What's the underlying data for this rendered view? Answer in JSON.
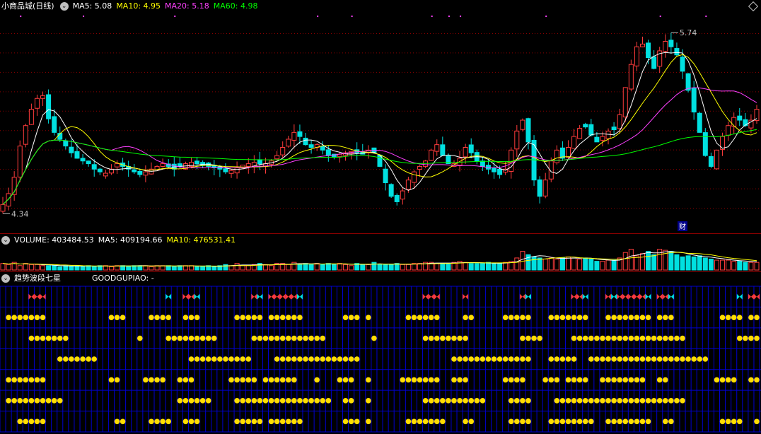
{
  "price_header": {
    "title": "小商品城(日线)",
    "ma5": "MA5: 5.08",
    "ma10": "MA10: 4.95",
    "ma20": "MA20: 5.18",
    "ma60": "MA60: 4.98"
  },
  "volume_header": {
    "volume": "VOLUME: 403484.53",
    "ma5": "MA5: 409194.66",
    "ma10": "MA10: 476531.41"
  },
  "indicator_header": {
    "title": "趋势波段七星",
    "good": "GOODGUPIAO: -"
  },
  "annotations": {
    "high": "5.74",
    "low": "4.34",
    "fin": "财"
  },
  "colors": {
    "up": "#ff3c3c",
    "down": "#00e0e0",
    "ma5": "#ffffff",
    "ma10": "#ffff00",
    "ma20": "#ff40ff",
    "ma60": "#00ff00",
    "grid": "#0000d0",
    "dot": "#ffdd00",
    "frame": "#8b0000"
  },
  "chart_data": {
    "type": "candlestick",
    "price_range": [
      4.25,
      5.82
    ],
    "closes": [
      4.42,
      4.5,
      4.62,
      4.85,
      5.0,
      5.12,
      5.2,
      5.22,
      5.05,
      4.95,
      4.9,
      4.85,
      4.8,
      4.76,
      4.74,
      4.72,
      4.68,
      4.66,
      4.65,
      4.68,
      4.72,
      4.7,
      4.68,
      4.66,
      4.64,
      4.66,
      4.68,
      4.7,
      4.72,
      4.7,
      4.68,
      4.7,
      4.72,
      4.73,
      4.72,
      4.71,
      4.7,
      4.69,
      4.68,
      4.66,
      4.67,
      4.69,
      4.71,
      4.72,
      4.73,
      4.72,
      4.72,
      4.74,
      4.78,
      4.84,
      4.9,
      4.95,
      4.92,
      4.86,
      4.84,
      4.86,
      4.82,
      4.78,
      4.77,
      4.79,
      4.8,
      4.81,
      4.8,
      4.79,
      4.82,
      4.8,
      4.7,
      4.58,
      4.48,
      4.44,
      4.52,
      4.6,
      4.66,
      4.7,
      4.74,
      4.82,
      4.86,
      4.78,
      4.72,
      4.72,
      4.76,
      4.84,
      4.8,
      4.74,
      4.7,
      4.68,
      4.66,
      4.64,
      4.68,
      4.82,
      4.96,
      5.04,
      4.88,
      4.6,
      4.48,
      4.6,
      4.74,
      4.82,
      4.76,
      4.84,
      4.92,
      4.98,
      4.99,
      4.93,
      4.88,
      4.92,
      4.96,
      4.97,
      5.08,
      5.28,
      5.45,
      5.58,
      5.6,
      5.5,
      5.42,
      5.55,
      5.62,
      5.58,
      5.52,
      5.4,
      5.26,
      5.1,
      4.95,
      4.78,
      4.7,
      4.82,
      4.92,
      5.0,
      5.06,
      5.04,
      5.0,
      5.04,
      5.12
    ],
    "volumes": [
      0.3,
      0.25,
      0.35,
      0.2,
      0.3,
      0.25,
      0.25,
      0.2,
      0.2,
      0.2,
      0.15,
      0.2,
      0.18,
      0.2,
      0.15,
      0.2,
      0.15,
      0.2,
      0.2,
      0.15,
      0.2,
      0.2,
      0.18,
      0.2,
      0.2,
      0.2,
      0.15,
      0.2,
      0.2,
      0.2,
      0.15,
      0.2,
      0.2,
      0.2,
      0.15,
      0.15,
      0.2,
      0.15,
      0.2,
      0.25,
      0.2,
      0.3,
      0.2,
      0.2,
      0.25,
      0.3,
      0.25,
      0.2,
      0.3,
      0.3,
      0.25,
      0.35,
      0.25,
      0.3,
      0.25,
      0.3,
      0.25,
      0.3,
      0.25,
      0.3,
      0.25,
      0.2,
      0.3,
      0.25,
      0.25,
      0.35,
      0.25,
      0.25,
      0.25,
      0.3,
      0.25,
      0.25,
      0.3,
      0.3,
      0.35,
      0.35,
      0.3,
      0.3,
      0.3,
      0.35,
      0.4,
      0.35,
      0.3,
      0.3,
      0.3,
      0.35,
      0.3,
      0.3,
      0.35,
      0.4,
      0.55,
      0.85,
      0.7,
      0.6,
      0.55,
      0.5,
      0.55,
      0.5,
      0.55,
      0.6,
      0.55,
      0.5,
      0.55,
      0.5,
      0.4,
      0.4,
      0.45,
      0.45,
      0.55,
      0.8,
      0.95,
      0.65,
      0.75,
      0.85,
      0.7,
      0.95,
      0.9,
      0.85,
      0.7,
      0.6,
      0.65,
      0.6,
      0.65,
      0.55,
      0.5,
      0.45,
      0.45,
      0.45,
      0.4,
      0.4,
      0.35,
      0.35,
      0.35
    ],
    "high_label": 5.74,
    "low_label": 4.34,
    "ma_legend": [
      "MA5",
      "MA10",
      "MA20",
      "MA60"
    ]
  }
}
